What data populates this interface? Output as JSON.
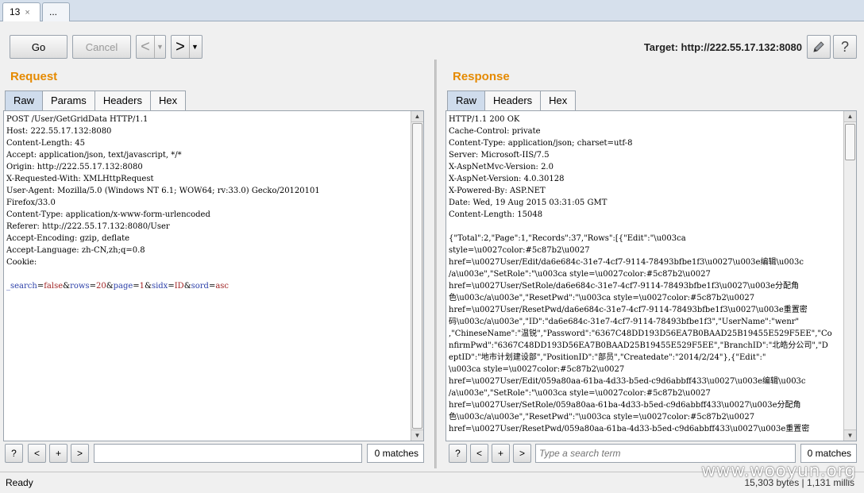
{
  "tabs": [
    {
      "label": "13",
      "close": "×"
    },
    {
      "label": "..."
    }
  ],
  "toolbar": {
    "go_label": "Go",
    "cancel_label": "Cancel",
    "back_arrow": "<",
    "forward_arrow": ">",
    "dropdown_glyph": "▼",
    "target_label": "Target: http://222.55.17.132:8080",
    "help_glyph": "?"
  },
  "request": {
    "title": "Request",
    "tabs": [
      "Raw",
      "Params",
      "Headers",
      "Hex"
    ],
    "lines": [
      "POST /User/GetGridData HTTP/1.1",
      "Host: 222.55.17.132:8080",
      "Content-Length: 45",
      "Accept: application/json, text/javascript, */*",
      "Origin: http://222.55.17.132:8080",
      "X-Requested-With: XMLHttpRequest",
      "User-Agent: Mozilla/5.0 (Windows NT 6.1; WOW64; rv:33.0) Gecko/20120101",
      "Firefox/33.0",
      "Content-Type: application/x-www-form-urlencoded",
      "Referer: http://222.55.17.132:8080/User",
      "Accept-Encoding: gzip, deflate",
      "Accept-Language: zh-CN,zh;q=0.8",
      "Cookie:",
      ""
    ],
    "body_params": [
      {
        "key": "_search",
        "value": "false"
      },
      {
        "key": "rows",
        "value": "20"
      },
      {
        "key": "page",
        "value": "1"
      },
      {
        "key": "sidx",
        "value": "ID"
      },
      {
        "key": "sord",
        "value": "asc"
      }
    ],
    "search": {
      "placeholder": "",
      "matches": "0 matches"
    }
  },
  "response": {
    "title": "Response",
    "tabs": [
      "Raw",
      "Headers",
      "Hex"
    ],
    "lines": [
      "HTTP/1.1 200 OK",
      "Cache-Control: private",
      "Content-Type: application/json; charset=utf-8",
      "Server: Microsoft-IIS/7.5",
      "X-AspNetMvc-Version: 2.0",
      "X-AspNet-Version: 4.0.30128",
      "X-Powered-By: ASP.NET",
      "Date: Wed, 19 Aug 2015 03:31:05 GMT",
      "Content-Length: 15048",
      "",
      "{\"Total\":2,\"Page\":1,\"Records\":37,\"Rows\":[{\"Edit\":\"\\u003ca",
      "style=\\u0027color:#5c87b2\\u0027",
      "href=\\u0027User/Edit/da6e684c-31e7-4cf7-9114-78493bfbe1f3\\u0027\\u003e编辑\\u003c",
      "/a\\u003e\",\"SetRole\":\"\\u003ca style=\\u0027color:#5c87b2\\u0027",
      "href=\\u0027User/SetRole/da6e684c-31e7-4cf7-9114-78493bfbe1f3\\u0027\\u003e分配角",
      "色\\u003c/a\\u003e\",\"ResetPwd\":\"\\u003ca style=\\u0027color:#5c87b2\\u0027",
      "href=\\u0027User/ResetPwd/da6e684c-31e7-4cf7-9114-78493bfbe1f3\\u0027\\u003e重置密",
      "码\\u003c/a\\u003e\",\"ID\":\"da6e684c-31e7-4cf7-9114-78493bfbe1f3\",\"UserName\":\"wenr\"",
      ",\"ChineseName\":\"温锐\",\"Password\":\"6367C48DD193D56EA7B0BAAD25B19455E529F5EE\",\"Co",
      "nfirmPwd\":\"6367C48DD193D56EA7B0BAAD25B19455E529F5EE\",\"BranchID\":\"北皓分公司\",\"D",
      "eptID\":\"地市计划建设部\",\"PositionID\":\"部员\",\"Createdate\":\"2014/2/24\"},{\"Edit\":\"",
      "\\u003ca style=\\u0027color:#5c87b2\\u0027",
      "href=\\u0027User/Edit/059a80aa-61ba-4d33-b5ed-c9d6abbff433\\u0027\\u003e编辑\\u003c",
      "/a\\u003e\",\"SetRole\":\"\\u003ca style=\\u0027color:#5c87b2\\u0027",
      "href=\\u0027User/SetRole/059a80aa-61ba-4d33-b5ed-c9d6abbff433\\u0027\\u003e分配角",
      "色\\u003c/a\\u003e\",\"ResetPwd\":\"\\u003ca style=\\u0027color:#5c87b2\\u0027",
      "href=\\u0027User/ResetPwd/059a80aa-61ba-4d33-b5ed-c9d6abbff433\\u0027\\u003e重置密"
    ],
    "search": {
      "placeholder": "Type a search term",
      "matches": "0 matches"
    }
  },
  "search_buttons": [
    "?",
    "<",
    "+",
    ">"
  ],
  "status": {
    "left": "Ready",
    "right": "15,303 bytes | 1,131 millis",
    "watermark": "www.wooyun.org"
  },
  "colors": {
    "accent_title": "#e58a00",
    "param_key": "#2b3fa8",
    "param_value": "#9e1f1f"
  }
}
